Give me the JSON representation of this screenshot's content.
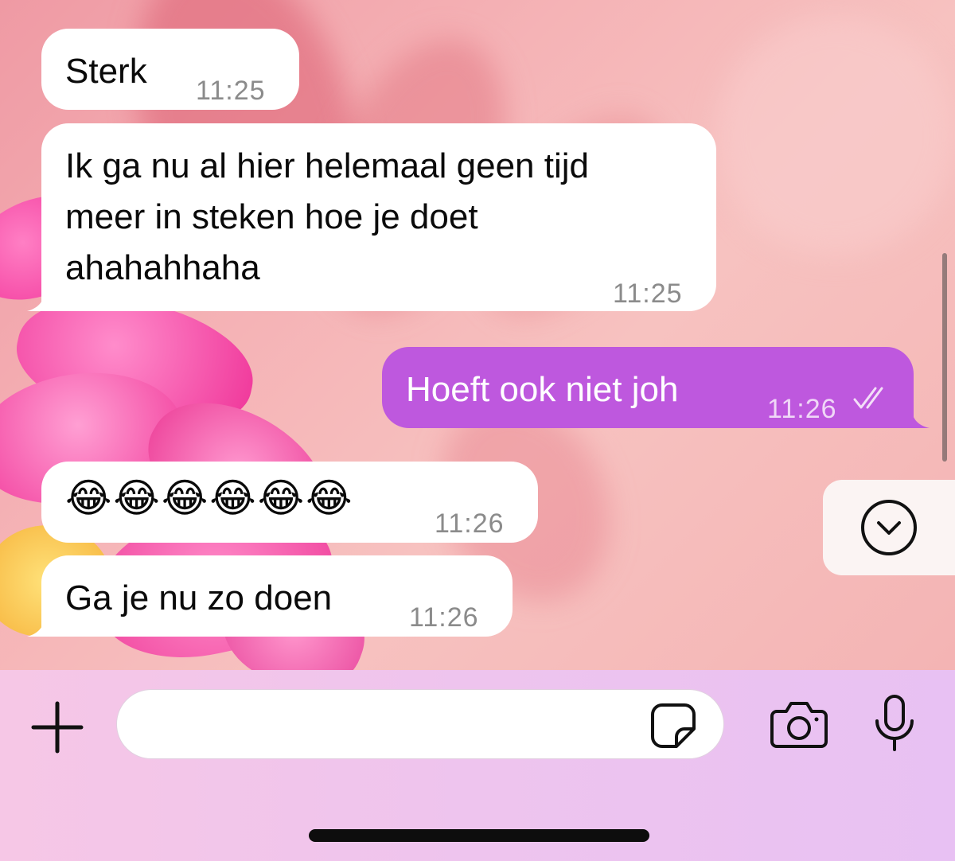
{
  "messages": [
    {
      "direction": "incoming",
      "text": "Sterk",
      "time": "11:25"
    },
    {
      "direction": "incoming",
      "lines": [
        "Ik ga nu al hier helemaal geen tijd",
        "meer in steken hoe je doet",
        "ahahahhaha"
      ],
      "time": "11:25"
    },
    {
      "direction": "outgoing",
      "text": "Hoeft ook niet joh",
      "time": "11:26",
      "status": "read"
    },
    {
      "direction": "incoming",
      "text": "😂😂😂😂😂😂",
      "time": "11:26"
    },
    {
      "direction": "incoming",
      "text": "Ga je nu zo doen",
      "time": "11:26"
    }
  ],
  "composer": {
    "placeholder": "",
    "icons": [
      "plus-icon",
      "sticker-icon",
      "camera-icon",
      "microphone-icon"
    ]
  },
  "scroll_button_icon": "chevron-down-circle-icon",
  "colors": {
    "outgoing_bubble": "#be58de",
    "incoming_bubble": "#ffffff",
    "composer_bg": "#eec4ee"
  }
}
